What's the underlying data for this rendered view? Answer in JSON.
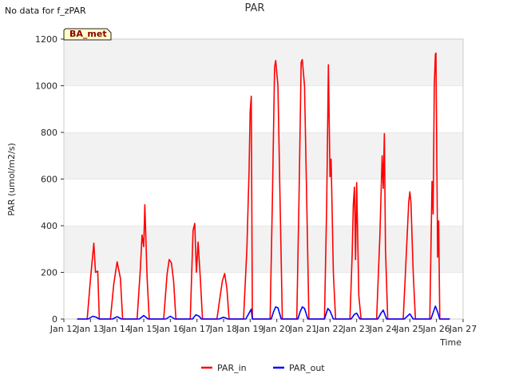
{
  "header": {
    "nodata_text": "No data for f_zPAR"
  },
  "chart_data": {
    "type": "line",
    "title": "PAR",
    "xlabel": "Time",
    "ylabel": "PAR (umol/m2/s)",
    "ylim": [
      0,
      1200
    ],
    "xlim": [
      "Jan 12",
      "Jan 27"
    ],
    "x_tick_labels": [
      "Jan 12",
      "Jan 13",
      "Jan 14",
      "Jan 15",
      "Jan 16",
      "Jan 17",
      "Jan 18",
      "Jan 19",
      "Jan 20",
      "Jan 21",
      "Jan 22",
      "Jan 23",
      "Jan 24",
      "Jan 25",
      "Jan 26",
      "Jan 27"
    ],
    "y_ticks": [
      0,
      200,
      400,
      600,
      800,
      1000,
      1200
    ],
    "grid": "horizontal bands",
    "legend_position": "bottom-center",
    "annotation": {
      "text": "BA_met",
      "bg": "#ffffcc",
      "color": "#8b0000"
    },
    "series": [
      {
        "name": "PAR_in",
        "color": "#ff0000",
        "points": [
          [
            "Jan 12 12:00",
            0
          ],
          [
            "Jan 12 21:00",
            0
          ],
          [
            "Jan 13 00:00",
            170
          ],
          [
            "Jan 13 03:00",
            325
          ],
          [
            "Jan 13 04:30",
            200
          ],
          [
            "Jan 13 06:30",
            205
          ],
          [
            "Jan 13 08:00",
            0
          ],
          [
            "Jan 13 18:00",
            0
          ],
          [
            "Jan 13 21:00",
            150
          ],
          [
            "Jan 14 00:00",
            245
          ],
          [
            "Jan 14 03:00",
            175
          ],
          [
            "Jan 14 05:00",
            0
          ],
          [
            "Jan 14 18:00",
            0
          ],
          [
            "Jan 14 21:00",
            215
          ],
          [
            "Jan 14 22:30",
            360
          ],
          [
            "Jan 15 00:00",
            310
          ],
          [
            "Jan 15 01:00",
            490
          ],
          [
            "Jan 15 03:00",
            180
          ],
          [
            "Jan 15 05:00",
            0
          ],
          [
            "Jan 15 18:00",
            0
          ],
          [
            "Jan 15 21:00",
            190
          ],
          [
            "Jan 15 23:00",
            255
          ],
          [
            "Jan 16 01:00",
            240
          ],
          [
            "Jan 16 03:00",
            160
          ],
          [
            "Jan 16 05:00",
            0
          ],
          [
            "Jan 16 18:00",
            0
          ],
          [
            "Jan 16 20:30",
            380
          ],
          [
            "Jan 16 22:00",
            410
          ],
          [
            "Jan 16 23:30",
            200
          ],
          [
            "Jan 17 01:00",
            330
          ],
          [
            "Jan 17 03:00",
            180
          ],
          [
            "Jan 17 05:00",
            0
          ],
          [
            "Jan 17 18:00",
            0
          ],
          [
            "Jan 17 21:00",
            100
          ],
          [
            "Jan 17 23:00",
            165
          ],
          [
            "Jan 18 01:00",
            195
          ],
          [
            "Jan 18 03:00",
            130
          ],
          [
            "Jan 18 05:00",
            0
          ],
          [
            "Jan 18 18:00",
            0
          ],
          [
            "Jan 18 21:00",
            300
          ],
          [
            "Jan 18 23:00",
            630
          ],
          [
            "Jan 19 00:00",
            890
          ],
          [
            "Jan 19 01:00",
            955
          ],
          [
            "Jan 19 02:00",
            0
          ],
          [
            "Jan 19 18:00",
            0
          ],
          [
            "Jan 19 20:00",
            500
          ],
          [
            "Jan 19 22:00",
            1080
          ],
          [
            "Jan 19 23:00",
            1108
          ],
          [
            "Jan 20 01:00",
            1000
          ],
          [
            "Jan 20 03:00",
            500
          ],
          [
            "Jan 20 05:00",
            0
          ],
          [
            "Jan 20 18:00",
            0
          ],
          [
            "Jan 20 20:00",
            500
          ],
          [
            "Jan 20 22:00",
            1100
          ],
          [
            "Jan 20 23:00",
            1112
          ],
          [
            "Jan 21 01:00",
            1000
          ],
          [
            "Jan 21 03:00",
            500
          ],
          [
            "Jan 21 05:00",
            0
          ],
          [
            "Jan 21 19:00",
            0
          ],
          [
            "Jan 21 21:00",
            500
          ],
          [
            "Jan 21 22:30",
            1090
          ],
          [
            "Jan 22 00:00",
            610
          ],
          [
            "Jan 22 01:00",
            685
          ],
          [
            "Jan 22 03:00",
            200
          ],
          [
            "Jan 22 05:00",
            0
          ],
          [
            "Jan 22 18:00",
            0
          ],
          [
            "Jan 22 20:00",
            280
          ],
          [
            "Jan 22 21:00",
            490
          ],
          [
            "Jan 22 22:00",
            565
          ],
          [
            "Jan 22 23:00",
            255
          ],
          [
            "Jan 23 00:00",
            585
          ],
          [
            "Jan 23 02:00",
            100
          ],
          [
            "Jan 23 04:00",
            0
          ],
          [
            "Jan 23 18:00",
            0
          ],
          [
            "Jan 23 21:00",
            360
          ],
          [
            "Jan 23 23:00",
            700
          ],
          [
            "Jan 24 00:00",
            560
          ],
          [
            "Jan 24 01:00",
            795
          ],
          [
            "Jan 24 02:00",
            300
          ],
          [
            "Jan 24 04:00",
            0
          ],
          [
            "Jan 24 18:00",
            0
          ],
          [
            "Jan 24 20:00",
            200
          ],
          [
            "Jan 24 23:00",
            500
          ],
          [
            "Jan 25 00:00",
            545
          ],
          [
            "Jan 25 01:00",
            500
          ],
          [
            "Jan 25 03:00",
            200
          ],
          [
            "Jan 25 05:00",
            0
          ],
          [
            "Jan 25 18:00",
            0
          ],
          [
            "Jan 25 20:00",
            590
          ],
          [
            "Jan 25 21:00",
            450
          ],
          [
            "Jan 25 22:00",
            1000
          ],
          [
            "Jan 25 23:00",
            1135
          ],
          [
            "Jan 25 23:30",
            1140
          ],
          [
            "Jan 26 00:00",
            850
          ],
          [
            "Jan 26 01:00",
            265
          ],
          [
            "Jan 26 02:00",
            420
          ],
          [
            "Jan 26 03:00",
            0
          ],
          [
            "Jan 26 12:00",
            0
          ]
        ]
      },
      {
        "name": "PAR_out",
        "color": "#0000ff",
        "points": [
          [
            "Jan 12 12:00",
            0
          ],
          [
            "Jan 12 22:00",
            0
          ],
          [
            "Jan 13 02:00",
            12
          ],
          [
            "Jan 13 05:00",
            8
          ],
          [
            "Jan 13 08:00",
            0
          ],
          [
            "Jan 13 20:00",
            0
          ],
          [
            "Jan 14 00:00",
            10
          ],
          [
            "Jan 14 04:00",
            0
          ],
          [
            "Jan 14 20:00",
            0
          ],
          [
            "Jan 15 00:00",
            15
          ],
          [
            "Jan 15 04:00",
            0
          ],
          [
            "Jan 15 20:00",
            0
          ],
          [
            "Jan 16 00:00",
            12
          ],
          [
            "Jan 16 04:00",
            0
          ],
          [
            "Jan 16 20:00",
            0
          ],
          [
            "Jan 16 23:00",
            18
          ],
          [
            "Jan 17 02:00",
            12
          ],
          [
            "Jan 17 04:00",
            0
          ],
          [
            "Jan 17 20:00",
            0
          ],
          [
            "Jan 18 00:00",
            8
          ],
          [
            "Jan 18 04:00",
            0
          ],
          [
            "Jan 18 20:00",
            0
          ],
          [
            "Jan 18 23:00",
            25
          ],
          [
            "Jan 19 01:00",
            42
          ],
          [
            "Jan 19 02:00",
            0
          ],
          [
            "Jan 19 19:00",
            0
          ],
          [
            "Jan 19 21:00",
            30
          ],
          [
            "Jan 19 23:00",
            52
          ],
          [
            "Jan 20 01:00",
            48
          ],
          [
            "Jan 20 04:00",
            0
          ],
          [
            "Jan 20 19:00",
            0
          ],
          [
            "Jan 20 21:00",
            30
          ],
          [
            "Jan 20 23:00",
            52
          ],
          [
            "Jan 21 01:00",
            45
          ],
          [
            "Jan 21 04:00",
            0
          ],
          [
            "Jan 21 19:00",
            0
          ],
          [
            "Jan 21 22:00",
            45
          ],
          [
            "Jan 22 00:00",
            35
          ],
          [
            "Jan 22 03:00",
            0
          ],
          [
            "Jan 22 19:00",
            0
          ],
          [
            "Jan 22 22:00",
            20
          ],
          [
            "Jan 23 00:00",
            25
          ],
          [
            "Jan 23 03:00",
            0
          ],
          [
            "Jan 23 19:00",
            0
          ],
          [
            "Jan 23 22:00",
            25
          ],
          [
            "Jan 24 00:00",
            38
          ],
          [
            "Jan 24 03:00",
            0
          ],
          [
            "Jan 24 19:00",
            0
          ],
          [
            "Jan 25 00:00",
            22
          ],
          [
            "Jan 25 03:00",
            0
          ],
          [
            "Jan 25 19:00",
            0
          ],
          [
            "Jan 25 23:00",
            55
          ],
          [
            "Jan 26 01:00",
            30
          ],
          [
            "Jan 26 03:00",
            0
          ],
          [
            "Jan 26 12:00",
            0
          ]
        ]
      }
    ]
  }
}
